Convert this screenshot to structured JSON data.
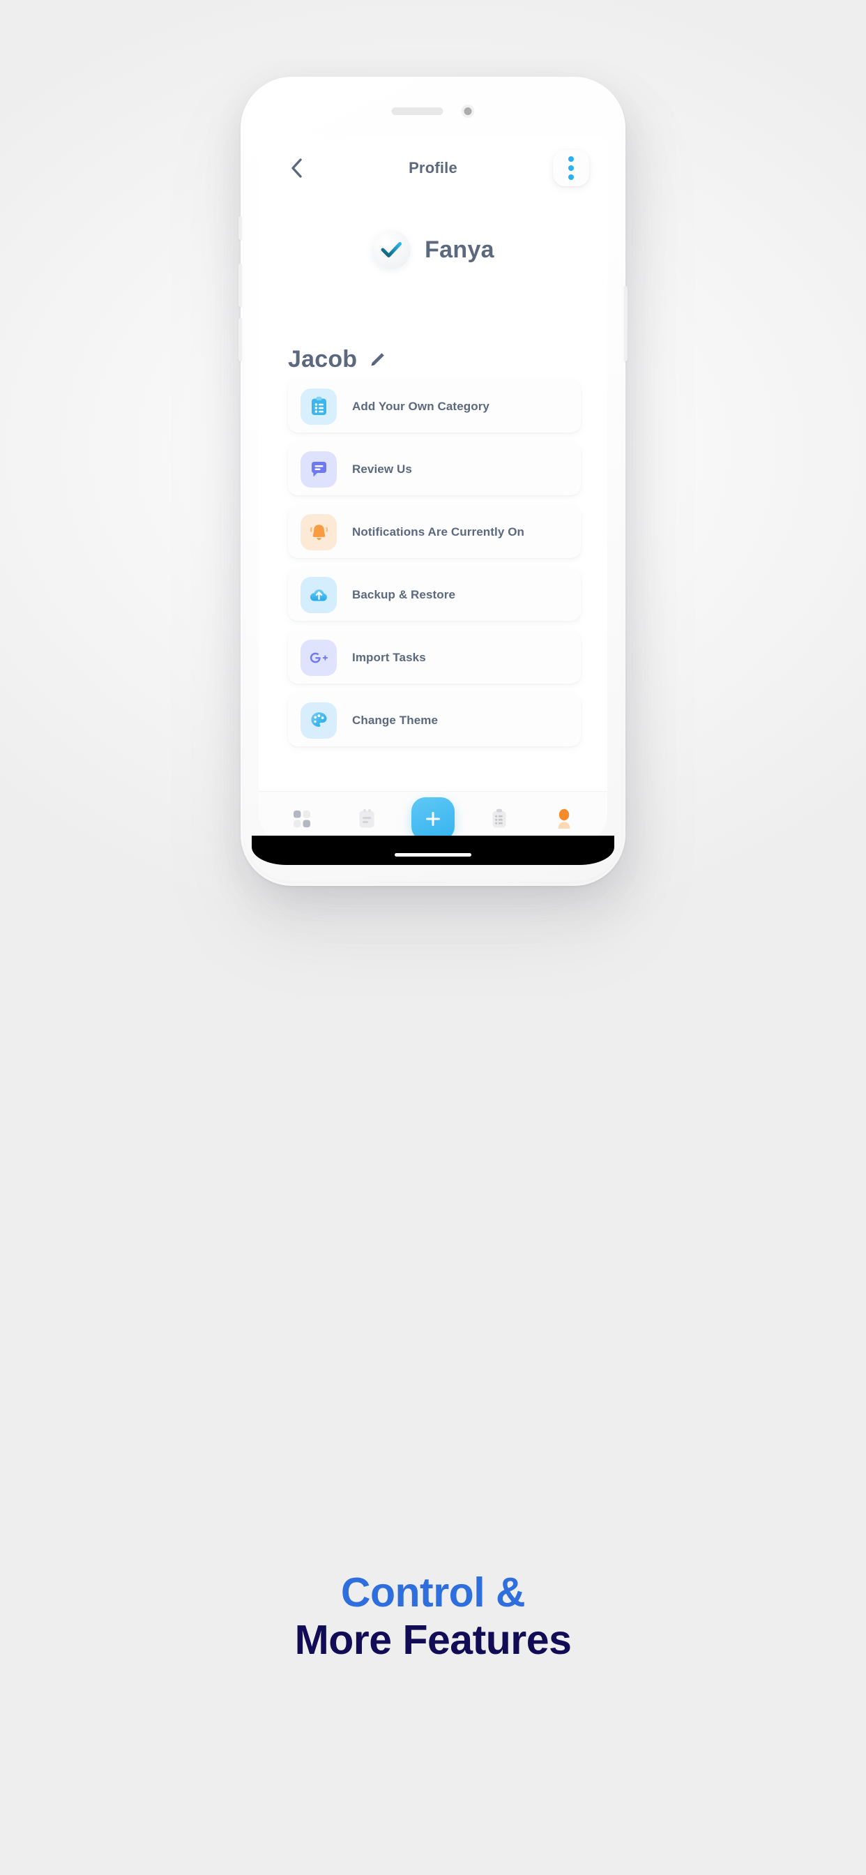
{
  "phone": {
    "speaker": "speaker-grille",
    "camera": "front-camera"
  },
  "header": {
    "back_icon": "chevron-left-icon",
    "title": "Profile",
    "menu_icon": "kebab-menu-icon"
  },
  "brand": {
    "logo_icon": "checkmark-logo-icon",
    "name": "Fanya"
  },
  "user": {
    "name": "Jacob",
    "edit_icon": "pencil-edit-icon"
  },
  "settings": {
    "items": [
      {
        "label": "Add Your Own Category",
        "icon": "clipboard-icon",
        "icon_bg": "#d8effd",
        "icon_color": "#3cb6ef"
      },
      {
        "label": "Review Us",
        "icon": "chat-bubble-icon",
        "icon_bg": "#dfe2fd",
        "icon_color": "#6f79ef"
      },
      {
        "label": "Notifications Are Currently On",
        "icon": "bell-icon",
        "icon_bg": "#fdead6",
        "icon_color": "#f7a councils"
      },
      {
        "label": "Backup & Restore",
        "icon": "cloud-upload-icon",
        "icon_bg": "#d5eefd",
        "icon_color": "#3cb6ef"
      },
      {
        "label": "Import Tasks",
        "icon": "google-plus-icon",
        "icon_bg": "#e0e3fd",
        "icon_color": "#6f79ef"
      },
      {
        "label": "Change Theme",
        "icon": "palette-icon",
        "icon_bg": "#d8eefd",
        "icon_color": "#3cb6ef"
      }
    ]
  },
  "bottom_nav": {
    "items": [
      {
        "icon": "grid-dashboard-icon"
      },
      {
        "icon": "notes-icon"
      },
      {
        "icon": "plus-add-icon"
      },
      {
        "icon": "checklist-icon"
      },
      {
        "icon": "profile-avatar-icon"
      }
    ]
  },
  "caption": {
    "line1": "Control &",
    "line2": "More Features"
  },
  "colors": {
    "accent_blue": "#29b0f0",
    "text_slate": "#5b687e",
    "caption_blue": "#2f6fdd",
    "caption_navy": "#110c55",
    "orange": "#f79c42"
  }
}
